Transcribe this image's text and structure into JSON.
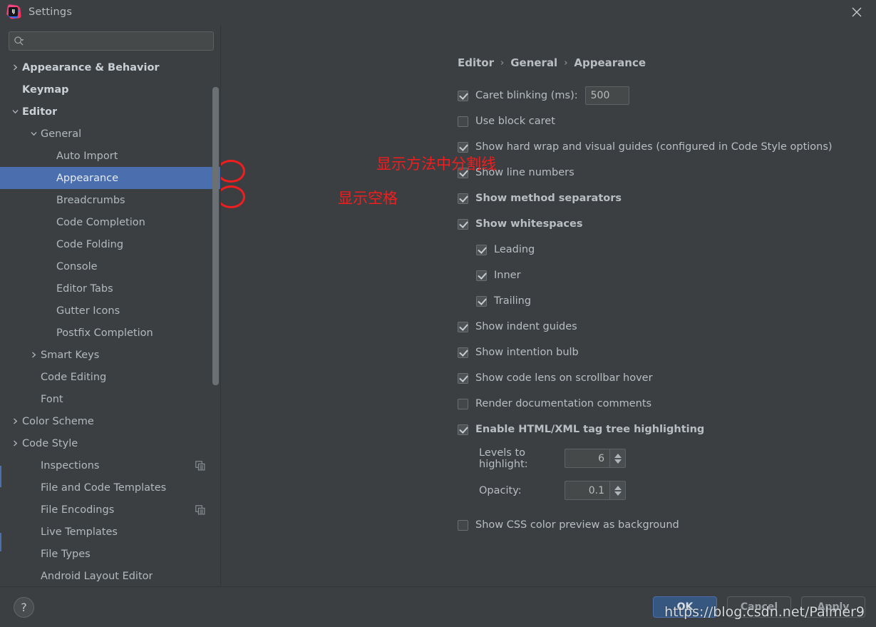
{
  "window": {
    "title": "Settings",
    "logo_icon": "intellij-idea-logo",
    "close_icon": "close-icon"
  },
  "sidebar": {
    "search": {
      "value": "",
      "placeholder": "",
      "icon": "search-icon",
      "dropdown_icon": "chevron-down-icon"
    },
    "items": [
      {
        "label": "Appearance & Behavior",
        "indent": 0,
        "arrow": "right",
        "bold": true,
        "selected": false,
        "copy_icon": false
      },
      {
        "label": "Keymap",
        "indent": 0,
        "arrow": "none",
        "bold": true,
        "selected": false,
        "copy_icon": false
      },
      {
        "label": "Editor",
        "indent": 0,
        "arrow": "down",
        "bold": true,
        "selected": false,
        "copy_icon": false
      },
      {
        "label": "General",
        "indent": 1,
        "arrow": "down",
        "bold": false,
        "selected": false,
        "copy_icon": false
      },
      {
        "label": "Auto Import",
        "indent": 2,
        "arrow": "none",
        "bold": false,
        "selected": false,
        "copy_icon": false
      },
      {
        "label": "Appearance",
        "indent": 2,
        "arrow": "none",
        "bold": false,
        "selected": true,
        "copy_icon": false
      },
      {
        "label": "Breadcrumbs",
        "indent": 2,
        "arrow": "none",
        "bold": false,
        "selected": false,
        "copy_icon": false
      },
      {
        "label": "Code Completion",
        "indent": 2,
        "arrow": "none",
        "bold": false,
        "selected": false,
        "copy_icon": false
      },
      {
        "label": "Code Folding",
        "indent": 2,
        "arrow": "none",
        "bold": false,
        "selected": false,
        "copy_icon": false
      },
      {
        "label": "Console",
        "indent": 2,
        "arrow": "none",
        "bold": false,
        "selected": false,
        "copy_icon": false
      },
      {
        "label": "Editor Tabs",
        "indent": 2,
        "arrow": "none",
        "bold": false,
        "selected": false,
        "copy_icon": false
      },
      {
        "label": "Gutter Icons",
        "indent": 2,
        "arrow": "none",
        "bold": false,
        "selected": false,
        "copy_icon": false
      },
      {
        "label": "Postfix Completion",
        "indent": 2,
        "arrow": "none",
        "bold": false,
        "selected": false,
        "copy_icon": false
      },
      {
        "label": "Smart Keys",
        "indent": 1,
        "arrow": "right",
        "bold": false,
        "selected": false,
        "copy_icon": false
      },
      {
        "label": "Code Editing",
        "indent": 1,
        "arrow": "none",
        "bold": false,
        "selected": false,
        "copy_icon": false
      },
      {
        "label": "Font",
        "indent": 1,
        "arrow": "none",
        "bold": false,
        "selected": false,
        "copy_icon": false
      },
      {
        "label": "Color Scheme",
        "indent": 0,
        "arrow": "right",
        "bold": false,
        "selected": false,
        "copy_icon": false
      },
      {
        "label": "Code Style",
        "indent": 0,
        "arrow": "right",
        "bold": false,
        "selected": false,
        "copy_icon": false
      },
      {
        "label": "Inspections",
        "indent": 1,
        "arrow": "none",
        "bold": false,
        "selected": false,
        "copy_icon": true
      },
      {
        "label": "File and Code Templates",
        "indent": 1,
        "arrow": "none",
        "bold": false,
        "selected": false,
        "copy_icon": false
      },
      {
        "label": "File Encodings",
        "indent": 1,
        "arrow": "none",
        "bold": false,
        "selected": false,
        "copy_icon": true
      },
      {
        "label": "Live Templates",
        "indent": 1,
        "arrow": "none",
        "bold": false,
        "selected": false,
        "copy_icon": false
      },
      {
        "label": "File Types",
        "indent": 1,
        "arrow": "none",
        "bold": false,
        "selected": false,
        "copy_icon": false
      },
      {
        "label": "Android Layout Editor",
        "indent": 1,
        "arrow": "none",
        "bold": false,
        "selected": false,
        "copy_icon": false
      }
    ]
  },
  "breadcrumb": {
    "part1": "Editor",
    "part2": "General",
    "part3": "Appearance",
    "separator": "›"
  },
  "settings": {
    "caret_blinking": {
      "label": "Caret blinking (ms):",
      "checked": true,
      "value": "500"
    },
    "use_block_caret": {
      "label": "Use block caret",
      "checked": false
    },
    "show_hard_wrap": {
      "label": "Show hard wrap and visual guides (configured in Code Style options)",
      "checked": true
    },
    "show_line_numbers": {
      "label": "Show line numbers",
      "checked": true
    },
    "show_method_separators": {
      "label": "Show method separators",
      "checked": true
    },
    "show_whitespaces": {
      "label": "Show whitespaces",
      "checked": true
    },
    "leading": {
      "label": "Leading",
      "checked": true
    },
    "inner": {
      "label": "Inner",
      "checked": true
    },
    "trailing": {
      "label": "Trailing",
      "checked": true
    },
    "show_indent_guides": {
      "label": "Show indent guides",
      "checked": true
    },
    "show_intention_bulb": {
      "label": "Show intention bulb",
      "checked": true
    },
    "show_code_lens": {
      "label": "Show code lens on scrollbar hover",
      "checked": true
    },
    "render_doc_comments": {
      "label": "Render documentation comments",
      "checked": false
    },
    "enable_html_xml": {
      "label": "Enable HTML/XML tag tree highlighting",
      "checked": true
    },
    "levels_to_highlight": {
      "label": "Levels to highlight:",
      "value": "6"
    },
    "opacity": {
      "label": "Opacity:",
      "value": "0.1"
    },
    "show_css_preview": {
      "label": "Show CSS color preview as background",
      "checked": false
    }
  },
  "annotations": [
    {
      "text": "显示方法中分割线",
      "color": "#f01e1e"
    },
    {
      "text": "显示空格",
      "color": "#f01e1e"
    }
  ],
  "footer": {
    "help_label": "?",
    "ok_label": "OK",
    "cancel_label": "Cancel",
    "apply_label": "Apply"
  },
  "watermark": {
    "text": "https://blog.csdn.net/Palmer9"
  },
  "colors": {
    "accent": "#4b6eaf",
    "ok_button": "#365880",
    "background": "#3c3f41",
    "annotation_red": "#f01e1e"
  }
}
